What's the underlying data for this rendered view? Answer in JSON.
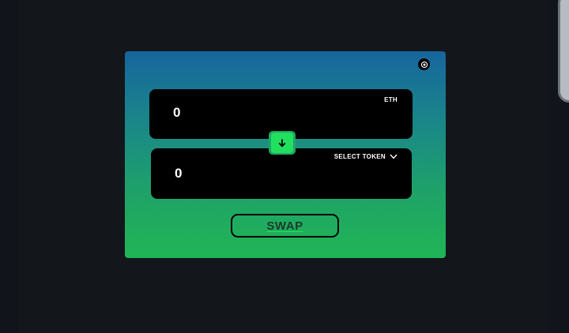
{
  "swap_card": {
    "from": {
      "amount": "0",
      "token": "ETH"
    },
    "to": {
      "amount": "0",
      "token_selector": "SELECT TOKEN"
    },
    "swap_label": "SWAP"
  },
  "icons": {
    "settings": "gear-icon",
    "switch": "arrow-down-icon",
    "dropdown": "chevron-down-icon"
  },
  "colors": {
    "background": "#13171c",
    "gradient_top": "#17659e",
    "gradient_bottom": "#20b555",
    "accent_green": "#22e05f",
    "box": "#000000"
  }
}
